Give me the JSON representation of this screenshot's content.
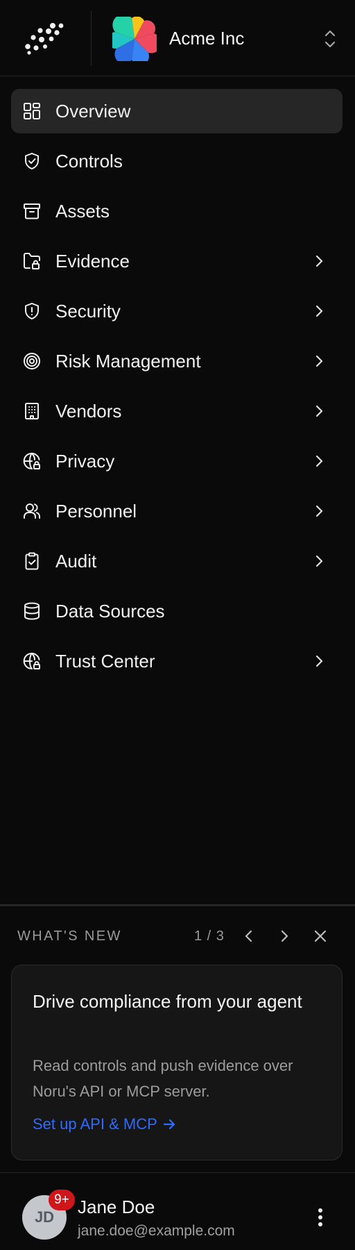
{
  "org": {
    "name": "Acme Inc"
  },
  "nav": {
    "items": [
      {
        "label": "Overview",
        "icon": "grid-icon",
        "active": true,
        "has_chevron": false
      },
      {
        "label": "Controls",
        "icon": "shield-check-icon",
        "active": false,
        "has_chevron": false
      },
      {
        "label": "Assets",
        "icon": "archive-icon",
        "active": false,
        "has_chevron": false
      },
      {
        "label": "Evidence",
        "icon": "folder-lock-icon",
        "active": false,
        "has_chevron": true
      },
      {
        "label": "Security",
        "icon": "shield-alert-icon",
        "active": false,
        "has_chevron": true
      },
      {
        "label": "Risk Management",
        "icon": "target-icon",
        "active": false,
        "has_chevron": true
      },
      {
        "label": "Vendors",
        "icon": "building-icon",
        "active": false,
        "has_chevron": true
      },
      {
        "label": "Privacy",
        "icon": "globe-lock-icon",
        "active": false,
        "has_chevron": true
      },
      {
        "label": "Personnel",
        "icon": "users-icon",
        "active": false,
        "has_chevron": true
      },
      {
        "label": "Audit",
        "icon": "clipboard-check-icon",
        "active": false,
        "has_chevron": true
      },
      {
        "label": "Data Sources",
        "icon": "database-icon",
        "active": false,
        "has_chevron": false
      },
      {
        "label": "Trust Center",
        "icon": "globe-lock-icon",
        "active": false,
        "has_chevron": true
      }
    ]
  },
  "whats_new": {
    "title": "WHAT'S NEW",
    "counter": "1 / 3",
    "card": {
      "title": "Drive compliance from your agent",
      "body": "Read controls and push evidence over Noru's API or MCP server.",
      "link": "Set up API & MCP"
    }
  },
  "user": {
    "initials": "JD",
    "badge": "9+",
    "name": "Jane Doe",
    "email": "jane.doe@example.com"
  },
  "colors": {
    "background": "#0a0a0a",
    "active_item": "#262626",
    "link": "#2f6bff",
    "badge": "#d0161b"
  }
}
